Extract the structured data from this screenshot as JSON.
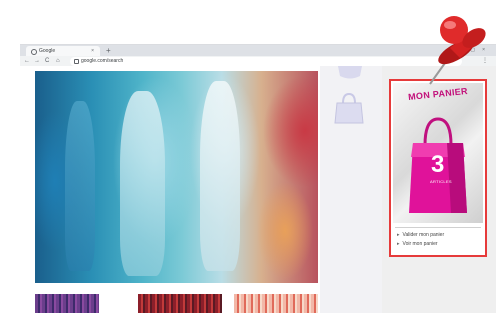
{
  "browser": {
    "tab_title": "Google",
    "tab_close": "×",
    "new_tab": "+",
    "window_controls": "–▢×",
    "url": "google.com/search",
    "back": "←",
    "forward": "→",
    "reload": "C",
    "home": "⌂",
    "menu": "⋮"
  },
  "cart": {
    "title": "MON PANIER",
    "count": "3",
    "count_label": "ARTICLES",
    "links": [
      "Valider mon panier",
      "Voir mon panier"
    ],
    "link_arrow": "▸"
  },
  "colors": {
    "cart_border": "#e63a3a",
    "bag_magenta": "#e0129a",
    "pin_red": "#e02b2b"
  },
  "icons": [
    "pushpin-icon",
    "shopping-bag-icon",
    "lock-icon"
  ]
}
